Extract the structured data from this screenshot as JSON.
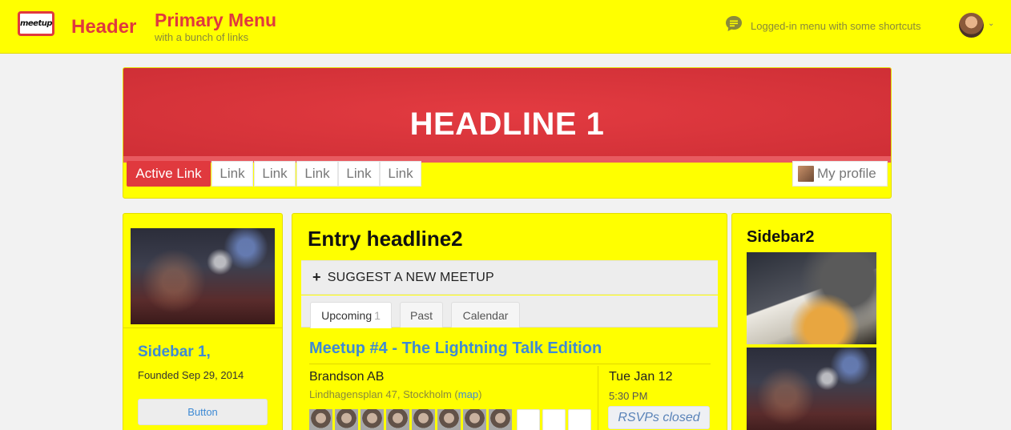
{
  "header": {
    "logo_text": "meetup",
    "title": "Header",
    "menu_title": "Primary Menu",
    "menu_subtitle": "with a bunch of links",
    "logged_menu_text": "Logged-in menu with some shortcuts",
    "icons": {
      "chat": "chat-bubble-icon",
      "chevron": "chevron-down-icon"
    }
  },
  "banner": {
    "headline": "HEADLINE 1",
    "nav": [
      {
        "label": "Active Link",
        "active": true
      },
      {
        "label": "Link"
      },
      {
        "label": "Link"
      },
      {
        "label": "Link"
      },
      {
        "label": "Link"
      },
      {
        "label": "Link"
      }
    ],
    "profile_label": "My profile"
  },
  "sidebar1": {
    "title": "Sidebar 1,",
    "subtitle": "Founded Sep 29, 2014",
    "button_label": "Button"
  },
  "main": {
    "entry_headline": "Entry headline2",
    "suggest_label": "SUGGEST A NEW MEETUP",
    "tabs": [
      {
        "label": "Upcoming",
        "count": "1",
        "active": true
      },
      {
        "label": "Past"
      },
      {
        "label": "Calendar"
      }
    ],
    "meetup": {
      "title": "Meetup #4 - The Lightning Talk Edition",
      "venue": "Brandson AB",
      "address": "Lindhagensplan 47, Stockholm",
      "map_open": "(",
      "map_link": "map",
      "map_close": ")",
      "date": "Tue Jan 12",
      "time": "5:30 PM",
      "rsvp_status": "RSVPs closed",
      "attendee_photos": 8,
      "empty_slots": 3
    }
  },
  "sidebar2": {
    "title": "Sidebar2"
  },
  "colors": {
    "background": "#ffff00",
    "accent": "#e0393e",
    "link": "#3e8ad4",
    "muted": "#8a8a3a"
  }
}
